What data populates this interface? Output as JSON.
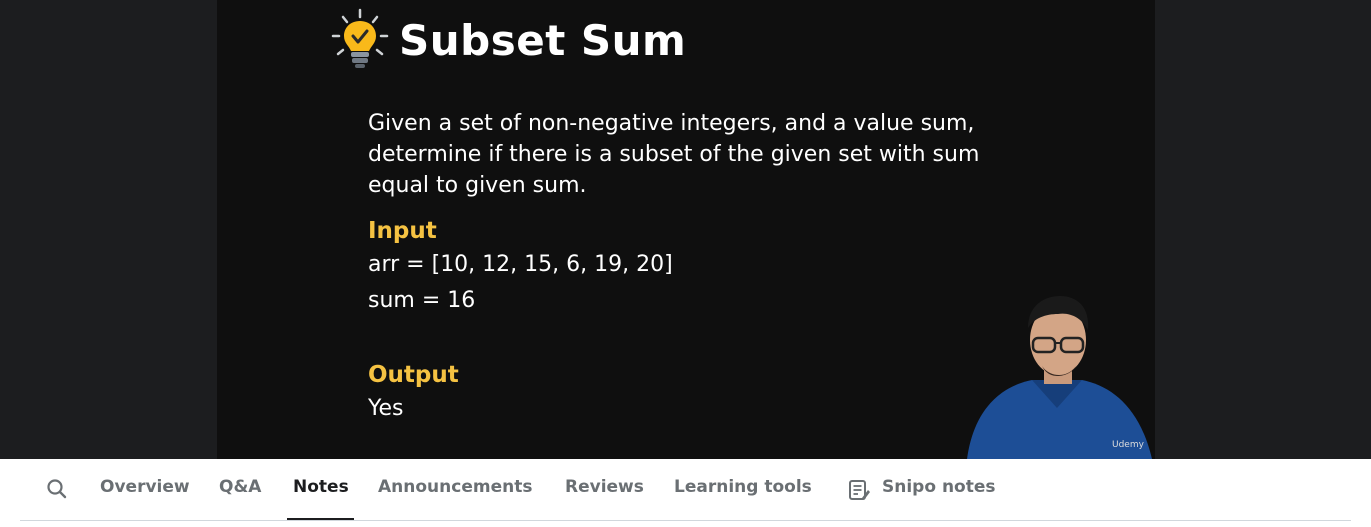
{
  "slide": {
    "title": "Subset Sum",
    "description": "Given a set of non-negative integers, and a value sum, determine if there is a subset of the given set with sum equal to given sum.",
    "input_heading": "Input",
    "input_line1": "arr = [10, 12, 15, 6, 19, 20]",
    "input_line2": "sum = 16",
    "output_heading": "Output",
    "output_value": "Yes",
    "accent_color": "#f5c242",
    "icon": "lightbulb-check-icon"
  },
  "watermark": "Udemy",
  "tabs": [
    {
      "label": "Overview"
    },
    {
      "label": "Q&A"
    },
    {
      "label": "Notes"
    },
    {
      "label": "Announcements"
    },
    {
      "label": "Reviews"
    },
    {
      "label": "Learning tools"
    },
    {
      "label": "Snipo notes"
    }
  ],
  "active_tab": "Notes"
}
